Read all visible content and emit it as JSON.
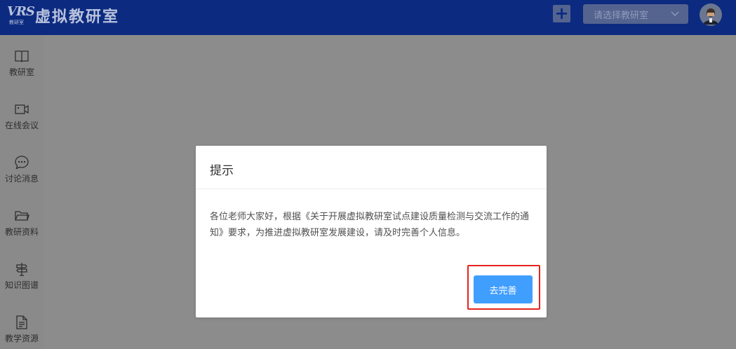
{
  "header": {
    "logo_mark": "VRS",
    "logo_sub": "教研室",
    "logo_title": "虚拟教研室",
    "add_icon": "plus-icon",
    "room_select": {
      "placeholder": "请选择教研室",
      "icon": "chevron-down-icon"
    },
    "avatar_icon": "user-avatar"
  },
  "sidebar": {
    "items": [
      {
        "label": "教研室",
        "icon": "book-icon"
      },
      {
        "label": "在线会议",
        "icon": "video-camera-icon"
      },
      {
        "label": "讨论消息",
        "icon": "chat-bubble-icon"
      },
      {
        "label": "教研资料",
        "icon": "folder-icon"
      },
      {
        "label": "知识图谱",
        "icon": "signpost-icon"
      },
      {
        "label": "教学资源",
        "icon": "document-icon"
      }
    ]
  },
  "dialog": {
    "title": "提示",
    "message": "各位老师大家好，根据《关于开展虚拟教研室试点建设质量检测与交流工作的通知》要求，为推进虚拟教研室发展建设，请及时完善个人信息。",
    "confirm_label": "去完善"
  },
  "colors": {
    "topbar": "#0c2a80",
    "overlay": "#8c8c8c",
    "primary": "#409eff",
    "highlight": "#e5231e"
  }
}
